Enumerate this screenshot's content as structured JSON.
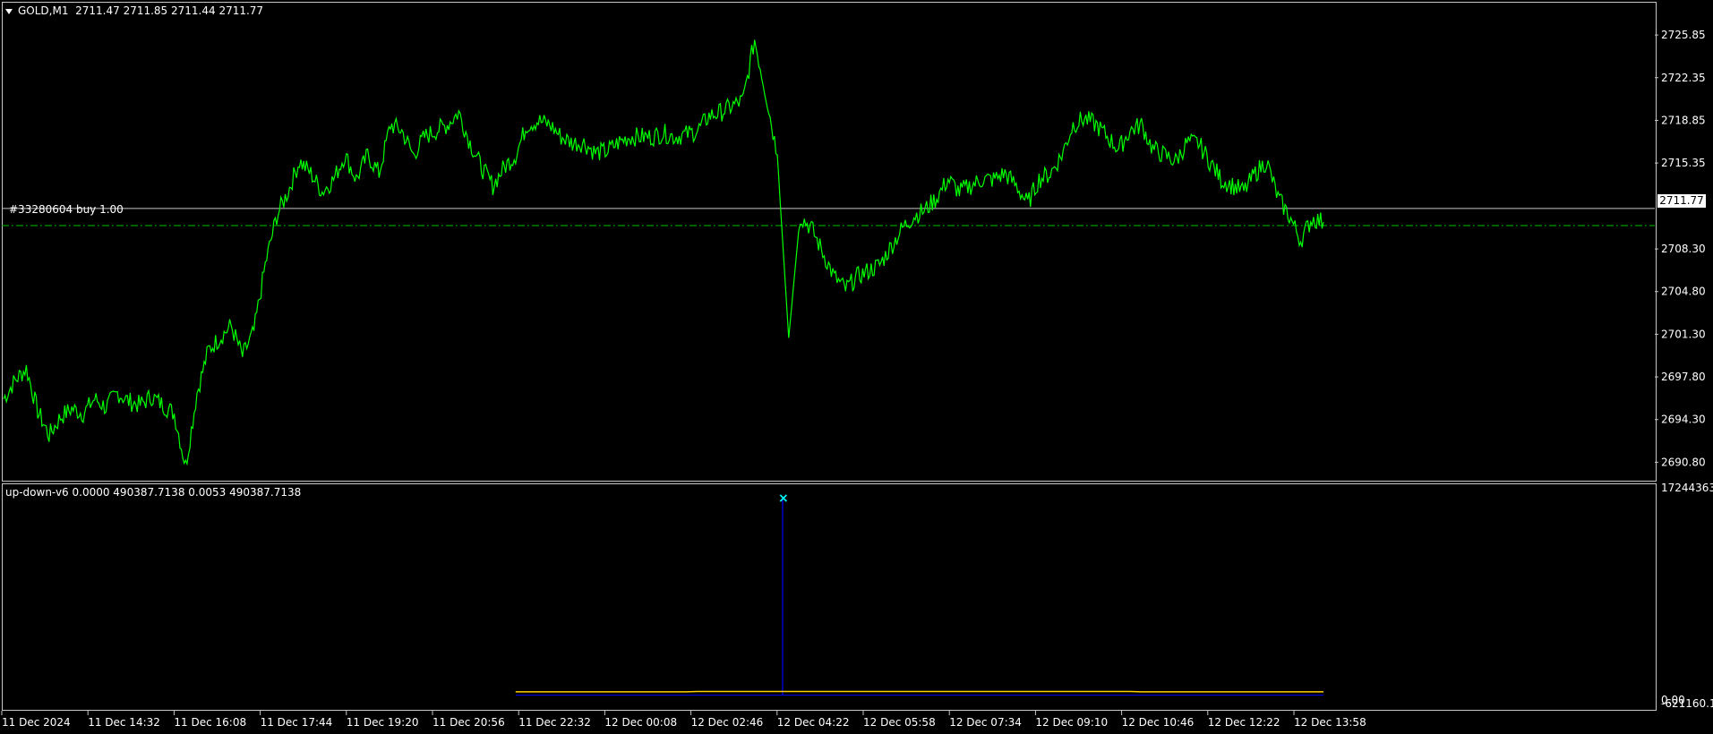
{
  "chart_header": {
    "symbol": "GOLD,M1",
    "ohlc": "2711.47 2711.85 2711.44 2711.77"
  },
  "order_line": {
    "label": "#33280604 buy 1.00"
  },
  "current_price": "2711.77",
  "indicator_header": "up-down-v6 0.0000 490387.7138 0.0053 490387.7138",
  "colors": {
    "background": "#000000",
    "price": "#00ff00",
    "order_line": "#00c000",
    "indicator_blue": "#0000ff",
    "indicator_yellow": "#ffd000",
    "marker": "#00ffff",
    "frame": "#c8c8c8"
  },
  "chart_data": {
    "type": "line",
    "title": "GOLD,M1",
    "xlabel": "",
    "ylabel": "",
    "price_axis": {
      "ticks": [
        "2725.85",
        "2722.35",
        "2718.85",
        "2715.35",
        "2711.77",
        "2708.30",
        "2704.80",
        "2701.30",
        "2697.80",
        "2694.30",
        "2690.80"
      ],
      "ylim": [
        2689.8,
        2727.4
      ]
    },
    "time_axis": {
      "ticks": [
        "11 Dec 2024",
        "11 Dec 14:32",
        "11 Dec 16:08",
        "11 Dec 17:44",
        "11 Dec 19:20",
        "11 Dec 20:56",
        "11 Dec 22:32",
        "12 Dec 00:08",
        "12 Dec 02:46",
        "12 Dec 04:22",
        "12 Dec 05:58",
        "12 Dec 07:34",
        "12 Dec 09:10",
        "12 Dec 10:46",
        "12 Dec 12:22",
        "12 Dec 13:58"
      ]
    },
    "order_price": 2710.8,
    "series": [
      {
        "name": "GOLD,M1",
        "values": [
          2696.0,
          2697.5,
          2698.5,
          2695.0,
          2693.0,
          2694.5,
          2695.2,
          2694.8,
          2696.0,
          2695.3,
          2696.5,
          2695.8,
          2695.5,
          2696.2,
          2695.5,
          2694.8,
          2690.5,
          2696.5,
          2700.0,
          2701.0,
          2702.0,
          2699.5,
          2701.5,
          2707.0,
          2711.0,
          2713.0,
          2715.5,
          2714.5,
          2713.0,
          2714.0,
          2716.0,
          2714.0,
          2716.0,
          2714.5,
          2718.5,
          2718.0,
          2716.0,
          2717.5,
          2718.0,
          2718.5,
          2719.5,
          2717.0,
          2715.0,
          2713.5,
          2715.0,
          2716.0,
          2718.5,
          2718.8,
          2718.5,
          2717.5,
          2717.0,
          2717.0,
          2716.2,
          2716.3,
          2717.0,
          2717.5,
          2717.5,
          2717.5,
          2717.8,
          2717.5,
          2717.7,
          2718.0,
          2719.2,
          2719.5,
          2720.0,
          2720.5,
          2725.5,
          2721.0,
          2716.0,
          2701.0,
          2711.0,
          2710.0,
          2708.0,
          2706.0,
          2705.0,
          2706.0,
          2706.5,
          2707.0,
          2708.5,
          2710.0,
          2711.0,
          2711.5,
          2712.5,
          2714.0,
          2713.0,
          2713.5,
          2714.0,
          2714.0,
          2714.5,
          2713.5,
          2712.0,
          2714.0,
          2714.5,
          2716.0,
          2718.5,
          2719.0,
          2718.5,
          2717.5,
          2716.5,
          2718.0,
          2718.5,
          2716.5,
          2716.0,
          2715.5,
          2717.0,
          2717.0,
          2715.5,
          2714.0,
          2713.5,
          2713.0,
          2714.5,
          2715.5,
          2712.5,
          2711.0,
          2709.0,
          2710.8,
          2710.5
        ]
      },
      {
        "name": "up-down-v6 line 1",
        "values": [
          0,
          0,
          0,
          0,
          0,
          0,
          0,
          0,
          0,
          0,
          0,
          0,
          0,
          0,
          0,
          0,
          0,
          0,
          0,
          0,
          0,
          0,
          0,
          0,
          0,
          0,
          0,
          0,
          0,
          0,
          0,
          0,
          0,
          0,
          0,
          0,
          0,
          0,
          0,
          0,
          0,
          0,
          0,
          0,
          0,
          0,
          0,
          0,
          0,
          0,
          0,
          0,
          0,
          0,
          0,
          0,
          0,
          0,
          0,
          0,
          0,
          0,
          0,
          0,
          0,
          0,
          0,
          0,
          0,
          17244363.0,
          0,
          0,
          0,
          0,
          0,
          0,
          0,
          0,
          0,
          0,
          0,
          0,
          0,
          0,
          0,
          0,
          0,
          0,
          0,
          0,
          0,
          0,
          0,
          0,
          0,
          0,
          0,
          0,
          0,
          0,
          0,
          0,
          0,
          0,
          0,
          0,
          0,
          0,
          0,
          0,
          0,
          0,
          0,
          0,
          0,
          0,
          0
        ]
      },
      {
        "name": "up-down-v6 line 2",
        "values": [
          0,
          0,
          0,
          0,
          0,
          0,
          0,
          0,
          0,
          0,
          0,
          0,
          0,
          0,
          0,
          0,
          0,
          0,
          0,
          0,
          0,
          0,
          0,
          0,
          0,
          0,
          0,
          0,
          0,
          0,
          0,
          0,
          0,
          0,
          0,
          0,
          0,
          0,
          0,
          0,
          0,
          0,
          0,
          0,
          0,
          0,
          0,
          0,
          0,
          0,
          0,
          0,
          0,
          0,
          0,
          0,
          0,
          0,
          0,
          0,
          0,
          0,
          0,
          0,
          0,
          0,
          0,
          0,
          0,
          0,
          0,
          0,
          0,
          0,
          0,
          0,
          0,
          0,
          0,
          0,
          0,
          0,
          0,
          0,
          0,
          0,
          0,
          0,
          0,
          0,
          0,
          0,
          0,
          0,
          0,
          0,
          0,
          0,
          0,
          0,
          0,
          0,
          0,
          0,
          0,
          0,
          0,
          0,
          0,
          0,
          0,
          0,
          0,
          0,
          0,
          0,
          0
        ]
      },
      {
        "name": "up-down-v6 line 3",
        "values": [
          0,
          0,
          0,
          0,
          0,
          0,
          0,
          0,
          0,
          0,
          0,
          0,
          0,
          0,
          0,
          0,
          0,
          0,
          0,
          0,
          0,
          0,
          0,
          0,
          0,
          0,
          0,
          0,
          0,
          0,
          0,
          0,
          0,
          0,
          0,
          0,
          0,
          0,
          0,
          0,
          0,
          0,
          0,
          0,
          0,
          0,
          0,
          0,
          0,
          0,
          0,
          0,
          0,
          0,
          0,
          0,
          0,
          0,
          0,
          0,
          0,
          0,
          0,
          0,
          0,
          0,
          0,
          0,
          0,
          0,
          0,
          0,
          0,
          0,
          0,
          0,
          0,
          0,
          0,
          0,
          0,
          0,
          0,
          0,
          0,
          0,
          0,
          0,
          0,
          0,
          0,
          0,
          0,
          0,
          0,
          0,
          0,
          0,
          0,
          0,
          0,
          0,
          0,
          0,
          0,
          0,
          0,
          0,
          0,
          0,
          0,
          0,
          0,
          0,
          0,
          0,
          0
        ]
      },
      {
        "name": "up-down-v6 line 4",
        "values": [
          null,
          null,
          null,
          null,
          null,
          null,
          null,
          null,
          null,
          null,
          null,
          null,
          null,
          null,
          null,
          null,
          null,
          null,
          null,
          null,
          null,
          null,
          null,
          null,
          null,
          null,
          null,
          null,
          null,
          null,
          null,
          null,
          null,
          null,
          null,
          null,
          null,
          null,
          null,
          null,
          null,
          null,
          null,
          null,
          null,
          252000,
          252000,
          252000,
          252000,
          252000,
          252000,
          252000,
          252000,
          252000,
          252000,
          252000,
          252000,
          252000,
          252000,
          252000,
          252000,
          252000,
          252000,
          252000,
          252000,
          252000,
          252000,
          252000,
          252000,
          252000,
          252000,
          252000,
          252000,
          252000,
          252000,
          252000,
          252000,
          252000,
          252000,
          252000,
          252000,
          252000,
          252000,
          252000,
          252000,
          252000,
          252000,
          252000,
          252000,
          252000,
          252000,
          252000,
          252000,
          252000,
          252000,
          252000,
          252000,
          252000,
          252000,
          252000,
          252000,
          252000,
          252000,
          252000,
          252000,
          252000,
          252000,
          252000,
          252000,
          252000,
          252000,
          252000,
          252000,
          252000,
          252000,
          252000,
          252000
        ]
      }
    ],
    "indicator_axis": {
      "ticks": [
        "17244363.",
        "0.00",
        "-621160.1"
      ],
      "ylim": [
        -621160.1,
        17244363.0
      ]
    }
  }
}
